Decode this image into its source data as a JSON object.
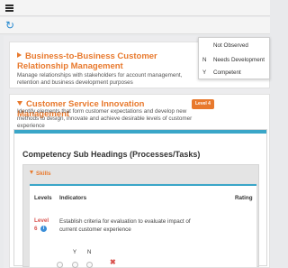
{
  "header": {
    "menu_icon": "hamburger-menu-icon",
    "refresh_icon": "refresh-icon"
  },
  "cards": [
    {
      "title": "Business-to-Business Customer Relationship Management",
      "description": "Manage relationships with stakeholders for account management, retention and business development purposes",
      "expanded": false
    },
    {
      "title": "Customer Service Innovation Management",
      "description": "Identify elements that form customer expectations and develop new methods to design, innovate and achieve desirable levels of customer experience",
      "level_badge": "Level 4",
      "expanded": true
    }
  ],
  "legend": {
    "items": [
      {
        "key": "",
        "label": "Not Observed"
      },
      {
        "key": "N",
        "label": "Needs Development"
      },
      {
        "key": "Y",
        "label": "Competent"
      }
    ]
  },
  "competency": {
    "heading": "Competency Sub Headings (Processes/Tasks)",
    "section_label": "Skills",
    "columns": {
      "levels": "Levels",
      "indicators": "Indicators",
      "rating": "Rating"
    },
    "rows": [
      {
        "level_label": "Level",
        "level_number": "6",
        "indicator": "Establish criteria for evaluation to evaluate impact of current customer experience"
      }
    ],
    "rating_options": {
      "yes": "Y",
      "no": "N",
      "clear": "✖"
    }
  },
  "colors": {
    "accent": "#e8792d",
    "info": "#3a8ed8",
    "danger": "#d9534f",
    "divider": "#3aa6c8"
  }
}
